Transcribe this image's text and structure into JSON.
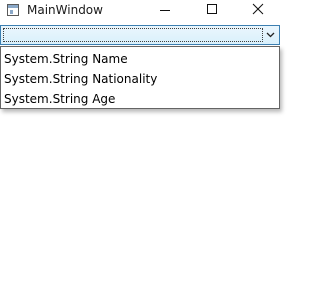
{
  "window": {
    "title": "MainWindow",
    "icon": "wpf-app-icon",
    "controls": [
      "minimize-icon",
      "maximize-icon",
      "close-icon"
    ]
  },
  "combobox": {
    "selected_value": "",
    "arrow_icon": "chevron-down-icon",
    "accent_color": "#3c7fb1",
    "items": [
      {
        "label": "System.String Name"
      },
      {
        "label": "System.String Nationality"
      },
      {
        "label": "System.String Age"
      }
    ]
  }
}
